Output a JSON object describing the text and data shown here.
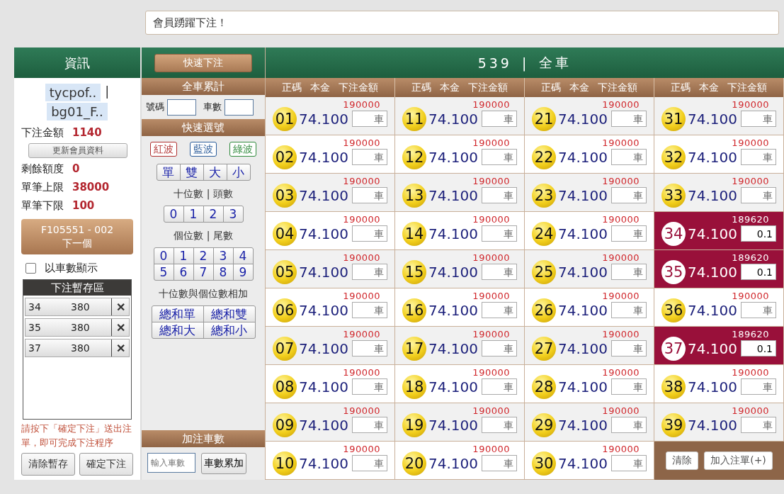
{
  "top_bar": {
    "marquee": "會員踴躍下注！"
  },
  "member_panel": {
    "title": "資訊",
    "user_tags": [
      "tycpof..",
      "bg01_F.."
    ],
    "separator": "|",
    "bet_amount": {
      "label": "下注金額",
      "value": "1140"
    },
    "update_button": "更新會員資料",
    "stats": [
      {
        "label": "剩餘額度",
        "value": "0"
      },
      {
        "label": "單筆上限",
        "value": "38000"
      },
      {
        "label": "單筆下限",
        "value": "100"
      }
    ],
    "next_button": {
      "code": "F105551 - 002",
      "label": "下一個"
    },
    "display_by_count": {
      "label": "以車數顯示",
      "checked": false
    },
    "staging": {
      "title": "下注暫存區",
      "items": [
        {
          "number": "34",
          "amount": "380",
          "remove": "✕"
        },
        {
          "number": "35",
          "amount": "380",
          "remove": "✕"
        },
        {
          "number": "37",
          "amount": "380",
          "remove": "✕"
        }
      ]
    },
    "notice": "請按下「確定下注」送出注單，即可完成下注程序",
    "buttons": [
      "清除暫存",
      "確定下注"
    ]
  },
  "quick_panel": {
    "quick_bet_button": "快速下注",
    "total_title": "全車累計",
    "number_label": "號碼",
    "count_label": "車數",
    "quick_title": "快速選號",
    "waves": [
      {
        "label": "紅波",
        "color": "#b03030"
      },
      {
        "label": "藍波",
        "color": "#2b5c9a"
      },
      {
        "label": "綠波",
        "color": "#2f8a3c"
      }
    ],
    "parity": [
      "單",
      "雙",
      "大",
      "小"
    ],
    "tens_label": "十位數 | 頭數",
    "tens": [
      "0",
      "1",
      "2",
      "3"
    ],
    "units_label": "個位數 | 尾數",
    "units": [
      "0",
      "1",
      "2",
      "3",
      "4",
      "5",
      "6",
      "7",
      "8",
      "9"
    ],
    "sum_label": "十位數與個位數相加",
    "sums": [
      "總和單",
      "總和雙",
      "總和大",
      "總和小"
    ],
    "add_title": "加注車數",
    "count_placeholder": "輸入車數",
    "add_button": "車數累加"
  },
  "board": {
    "title": "539",
    "separator": "|",
    "subtitle": "全車",
    "column_headers": [
      [
        "正碼",
        "本金",
        "下注金額"
      ],
      [
        "正碼",
        "本金",
        "下注金額"
      ],
      [
        "正碼",
        "本金",
        "下注金額"
      ],
      [
        "正碼",
        "本金",
        "下注金額"
      ]
    ],
    "cells": [
      {
        "number": "01",
        "odds": "74.100",
        "limit": "190000",
        "placeholder": "車",
        "selected": false
      },
      {
        "number": "02",
        "odds": "74.100",
        "limit": "190000",
        "placeholder": "車",
        "selected": false
      },
      {
        "number": "03",
        "odds": "74.100",
        "limit": "190000",
        "placeholder": "車",
        "selected": false
      },
      {
        "number": "04",
        "odds": "74.100",
        "limit": "190000",
        "placeholder": "車",
        "selected": false
      },
      {
        "number": "05",
        "odds": "74.100",
        "limit": "190000",
        "placeholder": "車",
        "selected": false
      },
      {
        "number": "06",
        "odds": "74.100",
        "limit": "190000",
        "placeholder": "車",
        "selected": false
      },
      {
        "number": "07",
        "odds": "74.100",
        "limit": "190000",
        "placeholder": "車",
        "selected": false
      },
      {
        "number": "08",
        "odds": "74.100",
        "limit": "190000",
        "placeholder": "車",
        "selected": false
      },
      {
        "number": "09",
        "odds": "74.100",
        "limit": "190000",
        "placeholder": "車",
        "selected": false
      },
      {
        "number": "10",
        "odds": "74.100",
        "limit": "190000",
        "placeholder": "車",
        "selected": false
      },
      {
        "number": "11",
        "odds": "74.100",
        "limit": "190000",
        "placeholder": "車",
        "selected": false
      },
      {
        "number": "12",
        "odds": "74.100",
        "limit": "190000",
        "placeholder": "車",
        "selected": false
      },
      {
        "number": "13",
        "odds": "74.100",
        "limit": "190000",
        "placeholder": "車",
        "selected": false
      },
      {
        "number": "14",
        "odds": "74.100",
        "limit": "190000",
        "placeholder": "車",
        "selected": false
      },
      {
        "number": "15",
        "odds": "74.100",
        "limit": "190000",
        "placeholder": "車",
        "selected": false
      },
      {
        "number": "16",
        "odds": "74.100",
        "limit": "190000",
        "placeholder": "車",
        "selected": false
      },
      {
        "number": "17",
        "odds": "74.100",
        "limit": "190000",
        "placeholder": "車",
        "selected": false
      },
      {
        "number": "18",
        "odds": "74.100",
        "limit": "190000",
        "placeholder": "車",
        "selected": false
      },
      {
        "number": "19",
        "odds": "74.100",
        "limit": "190000",
        "placeholder": "車",
        "selected": false
      },
      {
        "number": "20",
        "odds": "74.100",
        "limit": "190000",
        "placeholder": "車",
        "selected": false
      },
      {
        "number": "21",
        "odds": "74.100",
        "limit": "190000",
        "placeholder": "車",
        "selected": false
      },
      {
        "number": "22",
        "odds": "74.100",
        "limit": "190000",
        "placeholder": "車",
        "selected": false
      },
      {
        "number": "23",
        "odds": "74.100",
        "limit": "190000",
        "placeholder": "車",
        "selected": false
      },
      {
        "number": "24",
        "odds": "74.100",
        "limit": "190000",
        "placeholder": "車",
        "selected": false
      },
      {
        "number": "25",
        "odds": "74.100",
        "limit": "190000",
        "placeholder": "車",
        "selected": false
      },
      {
        "number": "26",
        "odds": "74.100",
        "limit": "190000",
        "placeholder": "車",
        "selected": false
      },
      {
        "number": "27",
        "odds": "74.100",
        "limit": "190000",
        "placeholder": "車",
        "selected": false
      },
      {
        "number": "28",
        "odds": "74.100",
        "limit": "190000",
        "placeholder": "車",
        "selected": false
      },
      {
        "number": "29",
        "odds": "74.100",
        "limit": "190000",
        "placeholder": "車",
        "selected": false
      },
      {
        "number": "30",
        "odds": "74.100",
        "limit": "190000",
        "placeholder": "車",
        "selected": false
      },
      {
        "number": "31",
        "odds": "74.100",
        "limit": "190000",
        "placeholder": "車",
        "selected": false
      },
      {
        "number": "32",
        "odds": "74.100",
        "limit": "190000",
        "placeholder": "車",
        "selected": false
      },
      {
        "number": "33",
        "odds": "74.100",
        "limit": "190000",
        "placeholder": "車",
        "selected": false
      },
      {
        "number": "34",
        "odds": "74.100",
        "limit": "189620",
        "value": "0.1",
        "selected": true
      },
      {
        "number": "35",
        "odds": "74.100",
        "limit": "189620",
        "value": "0.1",
        "selected": true
      },
      {
        "number": "36",
        "odds": "74.100",
        "limit": "190000",
        "placeholder": "車",
        "selected": false
      },
      {
        "number": "37",
        "odds": "74.100",
        "limit": "189620",
        "value": "0.1",
        "selected": true
      },
      {
        "number": "38",
        "odds": "74.100",
        "limit": "190000",
        "placeholder": "車",
        "selected": false
      },
      {
        "number": "39",
        "odds": "74.100",
        "limit": "190000",
        "placeholder": "車",
        "selected": false
      }
    ],
    "actions": [
      "清除",
      "加入注單(+)"
    ]
  }
}
